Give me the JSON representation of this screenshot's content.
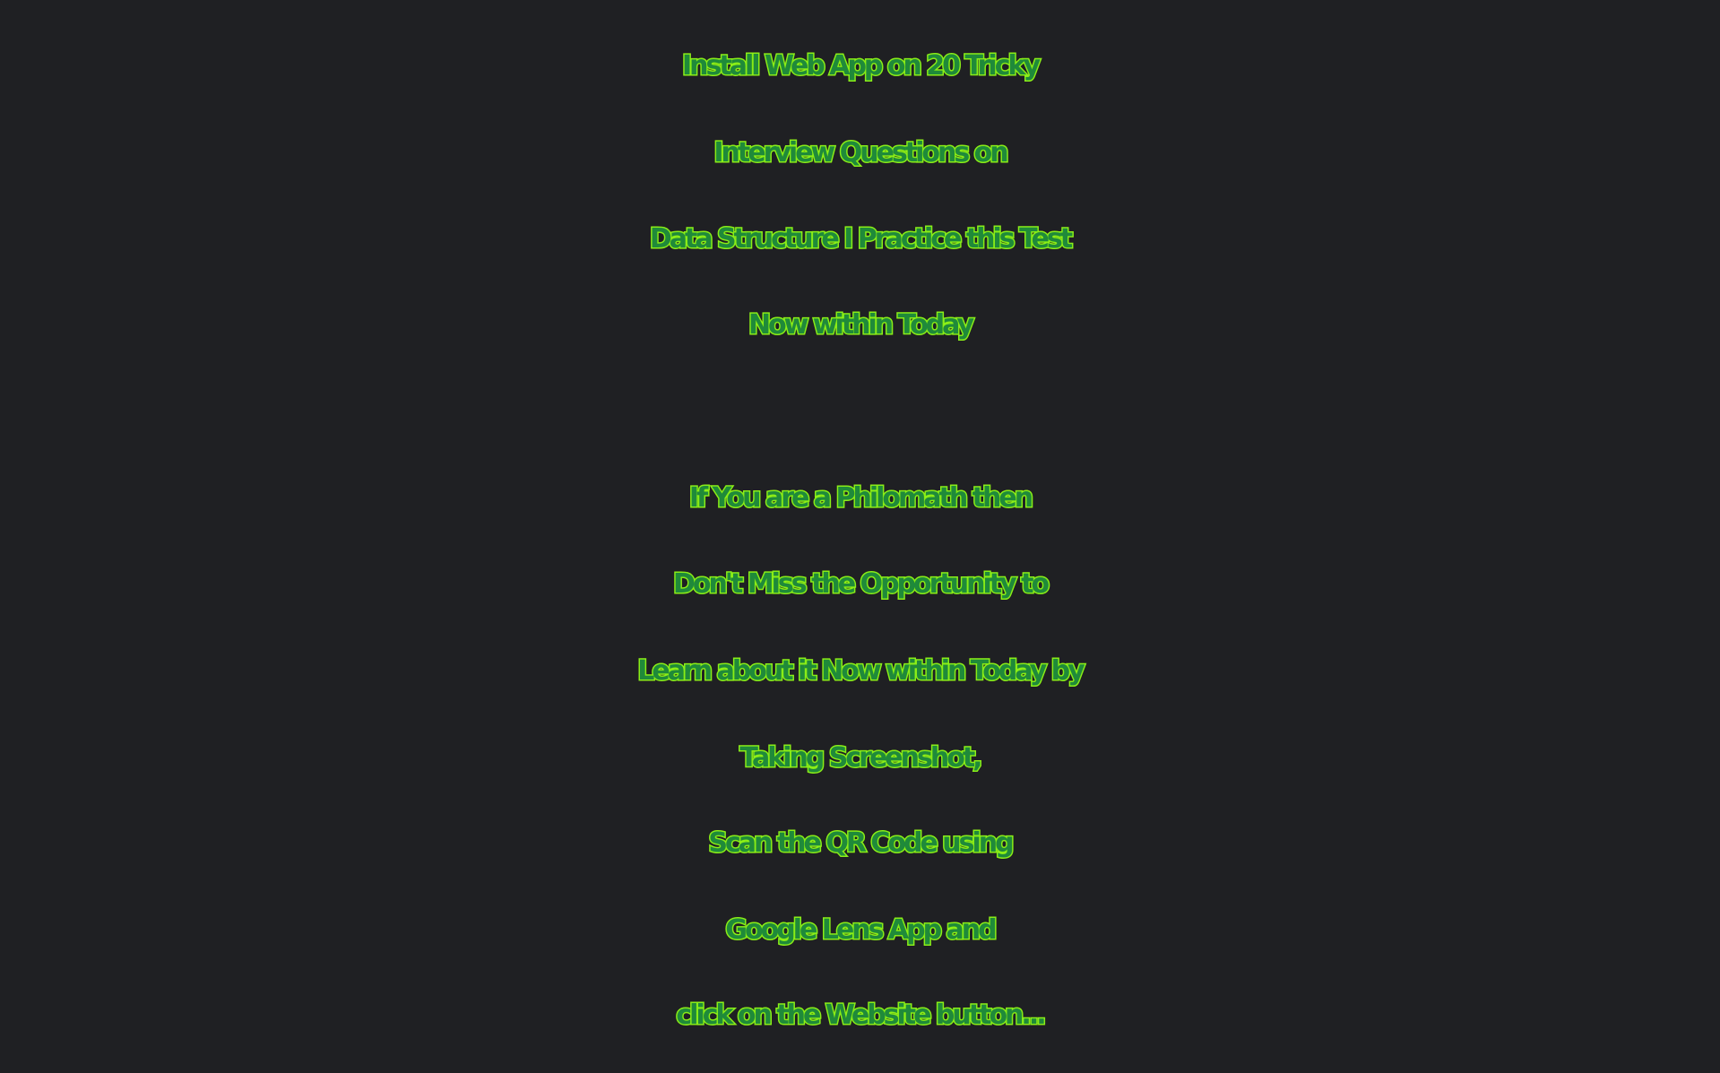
{
  "headline": {
    "lines": [
      "Install Web App on 20 Tricky",
      "Interview Questions on",
      "Data Structure I Practice this Test",
      "Now within Today"
    ]
  },
  "message": {
    "lines": [
      "If You are a Philomath then",
      "Don't Miss the Opportunity to",
      "Learn about it Now within Today by",
      "Taking Screenshot,",
      "Scan the QR Code using",
      "Google Lens App and",
      "click on the Website button..."
    ]
  },
  "colors": {
    "background": "#1f2023",
    "text_fill": "#1f8a3a",
    "text_outline": "#8df018"
  }
}
